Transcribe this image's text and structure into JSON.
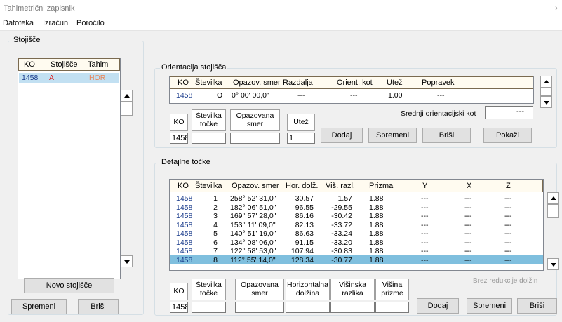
{
  "window": {
    "title": "Tahimetrični zapisnik",
    "close_glyph": "›"
  },
  "menu": [
    "Datoteka",
    "Izračun",
    "Poročilo"
  ],
  "stojisce": {
    "legend": "Stojišče",
    "headers": [
      "KO",
      "Stojišče",
      "Tahim"
    ],
    "rows": [
      {
        "ko": "1458",
        "stojisce": "A",
        "tahim": "HOR"
      }
    ],
    "new_button": "Novo stojišče",
    "edit_button": "Spremeni",
    "delete_button": "Briši"
  },
  "orientacija": {
    "legend": "Orientacija stojišča",
    "headers": [
      "KO",
      "Številka",
      "Opazov. smer",
      "Razdalja",
      "Orient. kot",
      "Utež",
      "Popravek"
    ],
    "rows": [
      {
        "ko": "1458",
        "stevilka": "O",
        "smer": "0° 00' 00,0\"",
        "razdalja": "---",
        "orient": "---",
        "utez": "1.00",
        "popravek": "---"
      }
    ],
    "labels": {
      "ko": "KO",
      "stevilka": "Številka točke",
      "smer": "Opazovana smer",
      "utez": "Utež"
    },
    "inputs": {
      "ko": "1458",
      "stevilka": "",
      "smer": "",
      "utez": "1"
    },
    "srednji_label": "Srednji orientacijski kot",
    "srednji_value": "---",
    "buttons": {
      "add": "Dodaj",
      "edit": "Spremeni",
      "delete": "Briši",
      "show": "Pokaži"
    }
  },
  "detajlne": {
    "legend": "Detajlne točke",
    "headers": [
      "KO",
      "Številka",
      "Opazov. smer",
      "Hor. dolž.",
      "Viš. razl.",
      "Prizma",
      "Y",
      "X",
      "Z"
    ],
    "rows": [
      {
        "ko": "1458",
        "st": "1",
        "smer": "258° 52' 31,0\"",
        "hor": "30.57",
        "vis": "1.57",
        "prizma": "1.88",
        "y": "---",
        "x": "---",
        "z": "---"
      },
      {
        "ko": "1458",
        "st": "2",
        "smer": "182° 06' 51,0\"",
        "hor": "96.55",
        "vis": "-29.55",
        "prizma": "1.88",
        "y": "---",
        "x": "---",
        "z": "---"
      },
      {
        "ko": "1458",
        "st": "3",
        "smer": "169° 57' 28,0\"",
        "hor": "86.16",
        "vis": "-30.42",
        "prizma": "1.88",
        "y": "---",
        "x": "---",
        "z": "---"
      },
      {
        "ko": "1458",
        "st": "4",
        "smer": "153° 11' 09,0\"",
        "hor": "82.13",
        "vis": "-33.72",
        "prizma": "1.88",
        "y": "---",
        "x": "---",
        "z": "---"
      },
      {
        "ko": "1458",
        "st": "5",
        "smer": "140° 51' 19,0\"",
        "hor": "86.63",
        "vis": "-33.24",
        "prizma": "1.88",
        "y": "---",
        "x": "---",
        "z": "---"
      },
      {
        "ko": "1458",
        "st": "6",
        "smer": "134° 08' 06,0\"",
        "hor": "91.15",
        "vis": "-33.20",
        "prizma": "1.88",
        "y": "---",
        "x": "---",
        "z": "---"
      },
      {
        "ko": "1458",
        "st": "7",
        "smer": "122° 58' 53,0\"",
        "hor": "107.94",
        "vis": "-30.83",
        "prizma": "1.88",
        "y": "---",
        "x": "---",
        "z": "---"
      },
      {
        "ko": "1458",
        "st": "8",
        "smer": "112° 55' 14,0\"",
        "hor": "128.34",
        "vis": "-30.77",
        "prizma": "1.88",
        "y": "---",
        "x": "---",
        "z": "---"
      }
    ],
    "labels": {
      "ko": "KO",
      "stevilka": "Številka točke",
      "smer": "Opazovana smer",
      "hor": "Horizontalna dolžina",
      "vis": "Višinska razlika",
      "prizma": "Višina prizme"
    },
    "inputs": {
      "ko": "1458",
      "stevilka": "",
      "smer": "",
      "hor": "",
      "vis": "",
      "prizma": ""
    },
    "note": "Brez redukcije dolžin",
    "buttons": {
      "add": "Dodaj",
      "edit": "Spremeni",
      "delete": "Briši"
    }
  }
}
